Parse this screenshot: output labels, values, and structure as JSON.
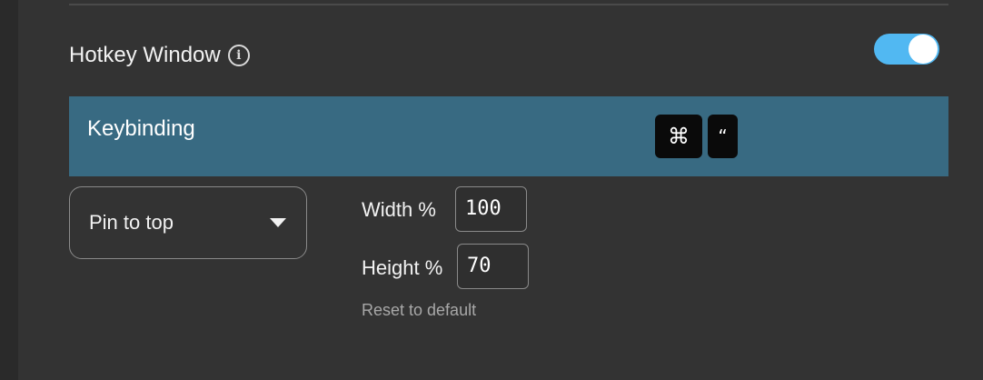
{
  "hotkey_window": {
    "label": "Hotkey Window",
    "info_icon": "info-circle-icon",
    "toggle_on": true,
    "toggle_color": "#51b8f2"
  },
  "keybinding": {
    "label": "Keybinding",
    "keys": [
      "⌘",
      "“"
    ],
    "bar_color": "#386a82"
  },
  "position_select": {
    "value": "Pin to top"
  },
  "width_field": {
    "label": "Width %",
    "value": "100"
  },
  "height_field": {
    "label": "Height %",
    "value": "70"
  },
  "reset_label": "Reset to default"
}
